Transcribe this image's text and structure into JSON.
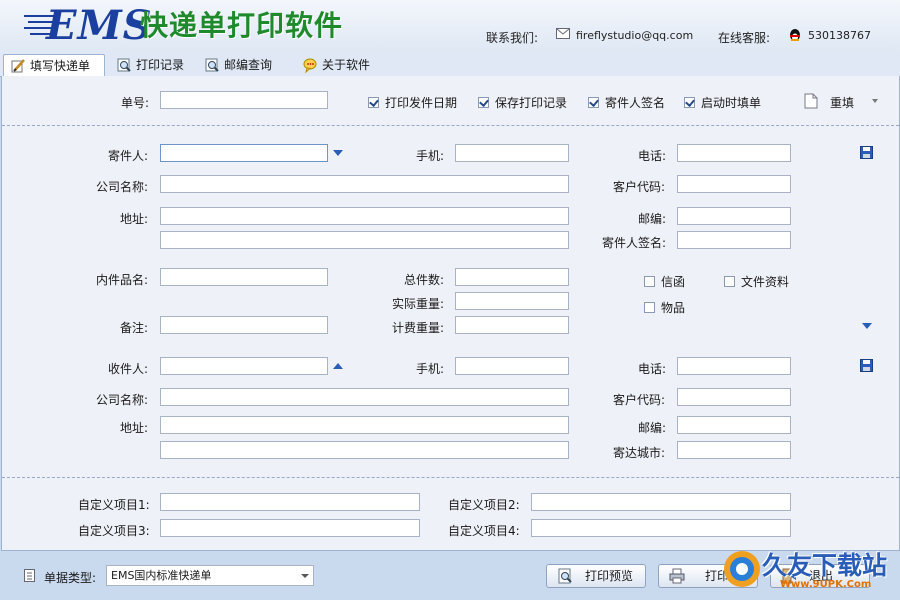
{
  "header": {
    "logo": "EMS",
    "title": "快递单打印软件",
    "contact_label": "联系我们:",
    "contact_email": "fireflystudio@qq.com",
    "service_label": "在线客服:",
    "service_qq": "530138767"
  },
  "tabs": [
    {
      "label": "填写快递单",
      "active": true,
      "icon": "pencil-icon"
    },
    {
      "label": "打印记录",
      "active": false,
      "icon": "magnifier-doc-icon"
    },
    {
      "label": "邮编查询",
      "active": false,
      "icon": "magnifier-doc-icon"
    },
    {
      "label": "关于软件",
      "active": false,
      "icon": "chat-icon"
    }
  ],
  "top_row": {
    "order_label": "单号:",
    "order_value": "",
    "options": [
      {
        "label": "打印发件日期",
        "checked": true
      },
      {
        "label": "保存打印记录",
        "checked": true
      },
      {
        "label": "寄件人签名",
        "checked": true
      },
      {
        "label": "启动时填单",
        "checked": true
      }
    ],
    "reset_label": "重填"
  },
  "sender": {
    "name_label": "寄件人:",
    "mobile_label": "手机:",
    "phone_label": "电话:",
    "company_label": "公司名称:",
    "customer_code_label": "客户代码:",
    "address_label": "地址:",
    "zip_label": "邮编:",
    "signature_label": "寄件人签名:"
  },
  "item": {
    "name_label": "内件品名:",
    "count_label": "总件数:",
    "actual_weight_label": "实际重量:",
    "note_label": "备注:",
    "charge_weight_label": "计费重量:",
    "types": [
      {
        "label": "信函",
        "checked": false
      },
      {
        "label": "文件资料",
        "checked": false
      },
      {
        "label": "物品",
        "checked": false
      }
    ]
  },
  "receiver": {
    "name_label": "收件人:",
    "mobile_label": "手机:",
    "phone_label": "电话:",
    "company_label": "公司名称:",
    "customer_code_label": "客户代码:",
    "address_label": "地址:",
    "zip_label": "邮编:",
    "city_label": "寄达城市:"
  },
  "custom": {
    "item1": "自定义项目1:",
    "item2": "自定义项目2:",
    "item3": "自定义项目3:",
    "item4": "自定义项目4:"
  },
  "footer": {
    "type_label": "单据类型:",
    "type_value": "EMS国内标准快递单",
    "preview_label": "打印预览",
    "print_label": "打印",
    "exit_label": "退出"
  },
  "watermark": {
    "text": "久友下载站",
    "url": "Www.9UPK.Com"
  },
  "colors": {
    "background": "#c9d9ee",
    "panel": "#eef1f7",
    "title_green": "#1f8a2b",
    "logo_blue": "#1a3f9e",
    "arrow_blue": "#2a5db8"
  }
}
